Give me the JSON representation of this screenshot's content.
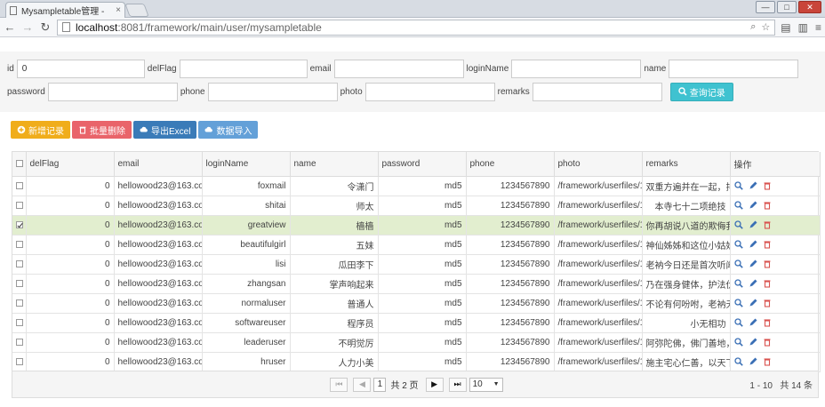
{
  "browser": {
    "tab_title": "Mysampletable管理 -",
    "tab_close": "×",
    "url_host": "localhost",
    "url_rest": ":8081/framework/main/user/mysampletable",
    "win_min": "—",
    "win_max": "□",
    "win_close": "✕"
  },
  "filter": {
    "fields_row1": [
      {
        "label": "id",
        "value": "0"
      },
      {
        "label": "delFlag",
        "value": ""
      },
      {
        "label": "email",
        "value": ""
      },
      {
        "label": "loginName",
        "value": ""
      },
      {
        "label": "name",
        "value": ""
      }
    ],
    "fields_row2": [
      {
        "label": "password",
        "value": ""
      },
      {
        "label": "phone",
        "value": ""
      },
      {
        "label": "photo",
        "value": ""
      },
      {
        "label": "remarks",
        "value": ""
      }
    ],
    "query_label": "查询记录"
  },
  "actions": {
    "add": "新增记录",
    "batch_delete": "批量删除",
    "export": "导出Excel",
    "import": "数据导入"
  },
  "table": {
    "headers": {
      "delflag": "delFlag",
      "email": "email",
      "loginname": "loginName",
      "name": "name",
      "password": "password",
      "phone": "phone",
      "photo": "photo",
      "remarks": "remarks",
      "ops": "操作"
    },
    "rows": [
      {
        "checked": false,
        "delFlag": "0",
        "email": "hellowood23@163.com",
        "loginName": "foxmail",
        "name": "令潇门",
        "password": "md5",
        "phone": "1234567890",
        "photo": "/framework/userfiles/1/im",
        "remarks": "双重方遍并在一起，排山倒"
      },
      {
        "checked": false,
        "delFlag": "0",
        "email": "hellowood23@163.com",
        "loginName": "shitai",
        "name": "师太",
        "password": "md5",
        "phone": "1234567890",
        "photo": "/framework/userfiles/1/im",
        "remarks": "本寺七十二项绝技"
      },
      {
        "checked": true,
        "delFlag": "0",
        "email": "hellowood23@163.com",
        "loginName": "greatview",
        "name": "樯樯",
        "password": "md5",
        "phone": "1234567890",
        "photo": "/framework/userfiles/1/im",
        "remarks": "你再胡说八道的欺侮我"
      },
      {
        "checked": false,
        "delFlag": "0",
        "email": "hellowood23@163.com",
        "loginName": "beautifulgirl",
        "name": "五妹",
        "password": "md5",
        "phone": "1234567890",
        "photo": "/framework/userfiles/1/im",
        "remarks": "神仙姊姊和这位小姑姊姊的"
      },
      {
        "checked": false,
        "delFlag": "0",
        "email": "hellowood23@163.com",
        "loginName": "lisi",
        "name": "瓜田李下",
        "password": "md5",
        "phone": "1234567890",
        "photo": "/framework/userfiles/1/im",
        "remarks": "老衲今日还是首次听闻"
      },
      {
        "checked": false,
        "delFlag": "0",
        "email": "hellowood23@163.com",
        "loginName": "zhangsan",
        "name": "掌声响起来",
        "password": "md5",
        "phone": "1234567890",
        "photo": "/framework/userfiles/1/im",
        "remarks": "乃在强身健体，护法伏魔"
      },
      {
        "checked": false,
        "delFlag": "0",
        "email": "hellowood23@163.com",
        "loginName": "normaluser",
        "name": "普通人",
        "password": "md5",
        "phone": "1234567890",
        "photo": "/framework/userfiles/1/im",
        "remarks": "不论有何吩咐，老衲无有不"
      },
      {
        "checked": false,
        "delFlag": "0",
        "email": "hellowood23@163.com",
        "loginName": "softwareuser",
        "name": "程序员",
        "password": "md5",
        "phone": "1234567890",
        "photo": "/framework/userfiles/1/im",
        "remarks": "小无相功"
      },
      {
        "checked": false,
        "delFlag": "0",
        "email": "hellowood23@163.com",
        "loginName": "leaderuser",
        "name": "不明觉厉",
        "password": "md5",
        "phone": "1234567890",
        "photo": "/framework/userfiles/1/im",
        "remarks": "阿弥陀佛，佛门善地，两位"
      },
      {
        "checked": false,
        "delFlag": "0",
        "email": "hellowood23@163.com",
        "loginName": "hruser",
        "name": "人力小美",
        "password": "md5",
        "phone": "1234567890",
        "photo": "/framework/userfiles/1/im",
        "remarks": "施主宅心仁善，以天下苍生"
      }
    ]
  },
  "pager": {
    "current_page": "1",
    "total_pages_text": "共 2 页",
    "page_size": "10",
    "range_text": "1 - 10",
    "total_text": "共 14 条"
  },
  "colors": {
    "add": "#f0ad1b",
    "delete": "#e9646a",
    "export": "#3a7bb8",
    "import": "#63a0d8",
    "query": "#3fc2d0",
    "selected_row": "#e2eecf",
    "icon_blue": "#3a6fb5",
    "icon_red": "#d9534f"
  }
}
